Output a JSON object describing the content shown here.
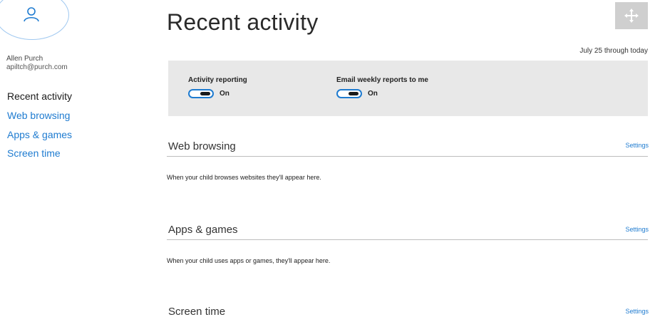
{
  "user": {
    "name": "Allen Purch",
    "email": "apiltch@purch.com"
  },
  "sidebar": {
    "items": [
      {
        "label": "Recent activity"
      },
      {
        "label": "Web browsing"
      },
      {
        "label": "Apps & games"
      },
      {
        "label": "Screen time"
      }
    ]
  },
  "main": {
    "title": "Recent activity",
    "date_range": "July 25 through today",
    "toggles": [
      {
        "label": "Activity reporting",
        "state": "On"
      },
      {
        "label": "Email weekly reports to me",
        "state": "On"
      }
    ],
    "sections": [
      {
        "title": "Web browsing",
        "link": "Settings",
        "description": "When your child browses websites they'll appear here."
      },
      {
        "title": "Apps & games",
        "link": "Settings",
        "description": "When your child uses apps or games, they'll appear here."
      },
      {
        "title": "Screen time",
        "link": "Settings"
      }
    ]
  },
  "colors": {
    "accent": "#1e7bd0",
    "panel_bg": "#e8e8e8",
    "move_button_bg": "#cfcfcf"
  },
  "icons": {
    "avatar": "person-icon",
    "move": "move-arrows-icon"
  }
}
